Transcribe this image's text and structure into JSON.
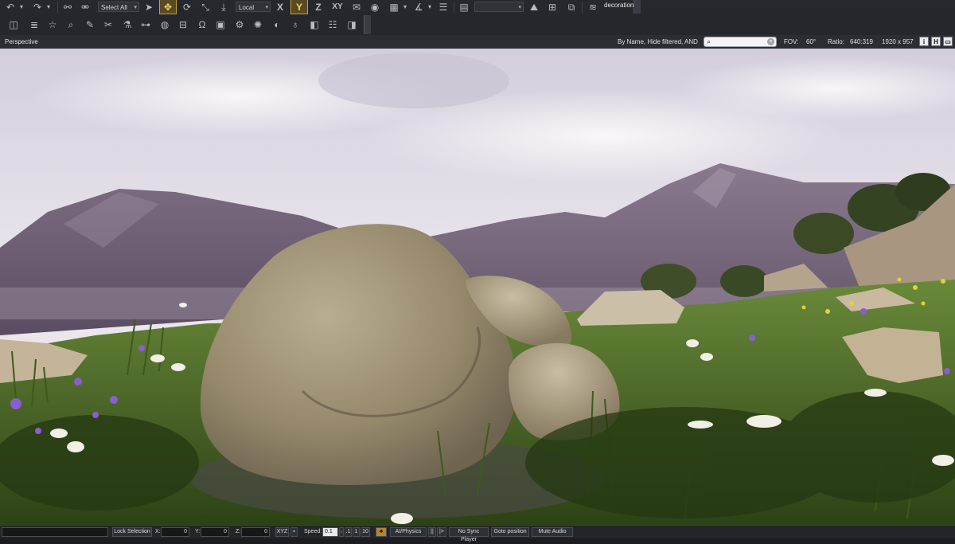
{
  "toolbar_top": {
    "select_all": "Select All",
    "coord_space": "Local",
    "axis_x": "X",
    "axis_y": "Y",
    "axis_z": "Z",
    "axis_xy": "XY",
    "layer_name": "decoration"
  },
  "viewport_bar": {
    "view_name": "Perspective",
    "filter_text": "By Name, Hide filtered, AND",
    "search_placeholder": "",
    "fov_label": "FOV:",
    "fov_value": "60°",
    "ratio_label": "Ratio:",
    "ratio_value": "640:319",
    "resolution": "1920 x 957",
    "btn_info": "i",
    "btn_h": "H",
    "btn_window": "▭"
  },
  "statusbar": {
    "lock_selection": "Lock Selection",
    "x_label": "X:",
    "x_value": "0",
    "y_label": "Y:",
    "y_value": "0",
    "z_label": "Z:",
    "z_value": "0",
    "xyz": "XYZ",
    "speed_label": "Speed:",
    "speed_value": "0.1",
    "speed_presets": [
      ".1",
      "1",
      "10"
    ],
    "ai_physics": "AI/Physics",
    "pause": "||",
    "step": "|>",
    "no_sync_player": "No Sync Player",
    "goto_position": "Goto position",
    "mute_audio": "Mute Audio"
  },
  "colors": {
    "toolbar_bg": "#25282c",
    "highlight": "#c9a13a",
    "sky_top": "#d9d2e0",
    "mountain": "#6f5e74",
    "grass": "#3f5a22",
    "rock": "#9a8e72"
  }
}
